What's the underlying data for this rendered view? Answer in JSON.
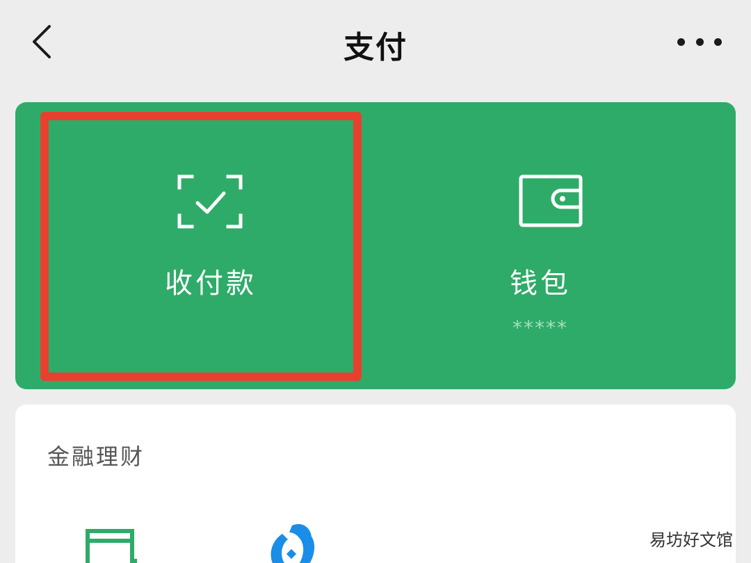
{
  "header": {
    "title": "支付",
    "back_icon": "chevron-left-icon",
    "more_icon": "more-dots-icon"
  },
  "pay_card": {
    "background_color": "#2eab68",
    "highlight_color": "#e8402f",
    "receive_pay": {
      "label": "收付款",
      "icon": "scan-check-icon"
    },
    "wallet": {
      "label": "钱包",
      "balance": "*****",
      "icon": "wallet-icon"
    }
  },
  "finance": {
    "title": "金融理财",
    "items": [
      {
        "icon": "card-icon"
      },
      {
        "icon": "fund-icon"
      }
    ]
  },
  "watermark": "易坊好文馆"
}
